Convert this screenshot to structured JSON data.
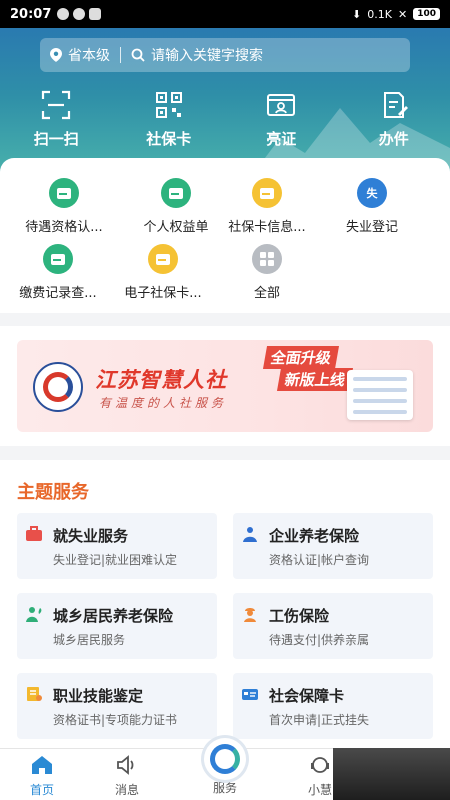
{
  "status_bar": {
    "time": "20:07",
    "network_speed": "0.1K",
    "battery": "100"
  },
  "header": {
    "location": "省本级",
    "search_placeholder": "请输入关键字搜索",
    "quick_actions": [
      {
        "label": "扫一扫",
        "icon": "scan-icon"
      },
      {
        "label": "社保卡",
        "icon": "qrcode-icon"
      },
      {
        "label": "亮证",
        "icon": "id-card-icon"
      },
      {
        "label": "办件",
        "icon": "edit-doc-icon"
      }
    ]
  },
  "services": [
    {
      "label": "待遇资格认...",
      "icon": "green-envelope-icon"
    },
    {
      "label": "个人权益单",
      "icon": "green-envelope-icon"
    },
    {
      "label": "社保卡信息...",
      "icon": "yellow-envelope-icon"
    },
    {
      "label": "失业登记",
      "icon": "blue-badge-icon",
      "badge": "失"
    },
    {
      "label": "缴费记录查...",
      "icon": "green-envelope-icon"
    },
    {
      "label": "电子社保卡...",
      "icon": "yellow-envelope-icon"
    },
    {
      "label": "全部",
      "icon": "grid-icon"
    }
  ],
  "banner": {
    "title": "江苏智慧人社",
    "slogan": "有温度的人社服务",
    "tag1": "全面升级",
    "tag2": "新版上线"
  },
  "theme": {
    "title": "主题服务",
    "cards": [
      {
        "title": "就失业服务",
        "subtitle": "失业登记|就业困难认定",
        "icon": "briefcase-icon"
      },
      {
        "title": "企业养老保险",
        "subtitle": "资格认证|帐户查询",
        "icon": "elder-icon"
      },
      {
        "title": "城乡居民养老保险",
        "subtitle": "城乡居民服务",
        "icon": "person-plant-icon"
      },
      {
        "title": "工伤保险",
        "subtitle": "待遇支付|供养亲属",
        "icon": "worker-icon"
      },
      {
        "title": "职业技能鉴定",
        "subtitle": "资格证书|专项能力证书",
        "icon": "certificate-icon"
      },
      {
        "title": "社会保障卡",
        "subtitle": "首次申请|正式挂失",
        "icon": "card-icon"
      }
    ]
  },
  "bottom_nav": [
    {
      "label": "首页",
      "active": true
    },
    {
      "label": "消息",
      "active": false
    },
    {
      "label": "服务",
      "active": false
    },
    {
      "label": "小慧",
      "active": false
    }
  ],
  "colors": {
    "accent": "#2a8ad4",
    "theme_title": "#e8672a",
    "header_top": "#2a7ab0",
    "header_bottom": "#4ab3ac"
  }
}
